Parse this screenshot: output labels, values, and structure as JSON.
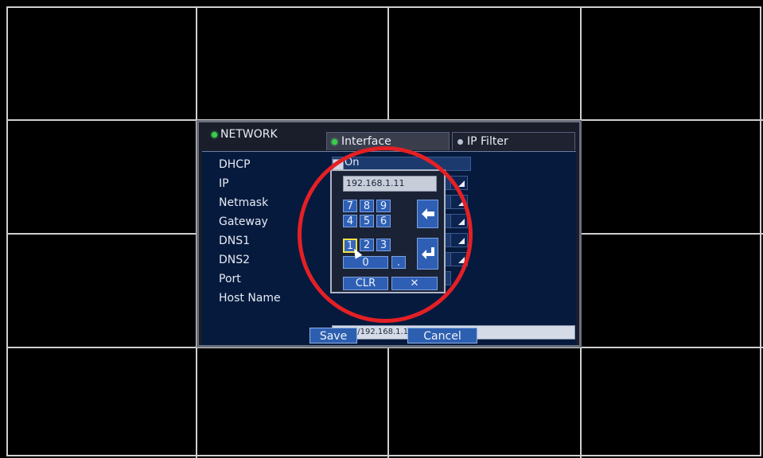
{
  "network": {
    "title": "NETWORK",
    "tabs": [
      {
        "label": "Interface",
        "active": true
      },
      {
        "label": "IP Filter",
        "active": false
      }
    ],
    "labels": {
      "dhcp": "DHCP",
      "ip": "IP",
      "netmask": "Netmask",
      "gateway": "Gateway",
      "dns1": "DNS1",
      "dns2": "DNS2",
      "port": "Port",
      "host_name": "Host Name"
    },
    "dhcp_value": "On",
    "host_name_value": "http://192.168.1.11:7001",
    "save_label": "Save",
    "cancel_label": "Cancel"
  },
  "keypad": {
    "display_value": "192.168.1.11",
    "keys": [
      "7",
      "8",
      "9",
      "4",
      "5",
      "6",
      "1",
      "2",
      "3",
      "0",
      "."
    ],
    "clear_label": "CLR",
    "close_label": "✕",
    "backspace_icon": "backspace-arrow-icon",
    "enter_icon": "enter-return-icon",
    "selected_key": "1"
  },
  "colors": {
    "annotation": "#e42025",
    "accent": "#2e5fb5",
    "status_dot": "#35d04a"
  }
}
